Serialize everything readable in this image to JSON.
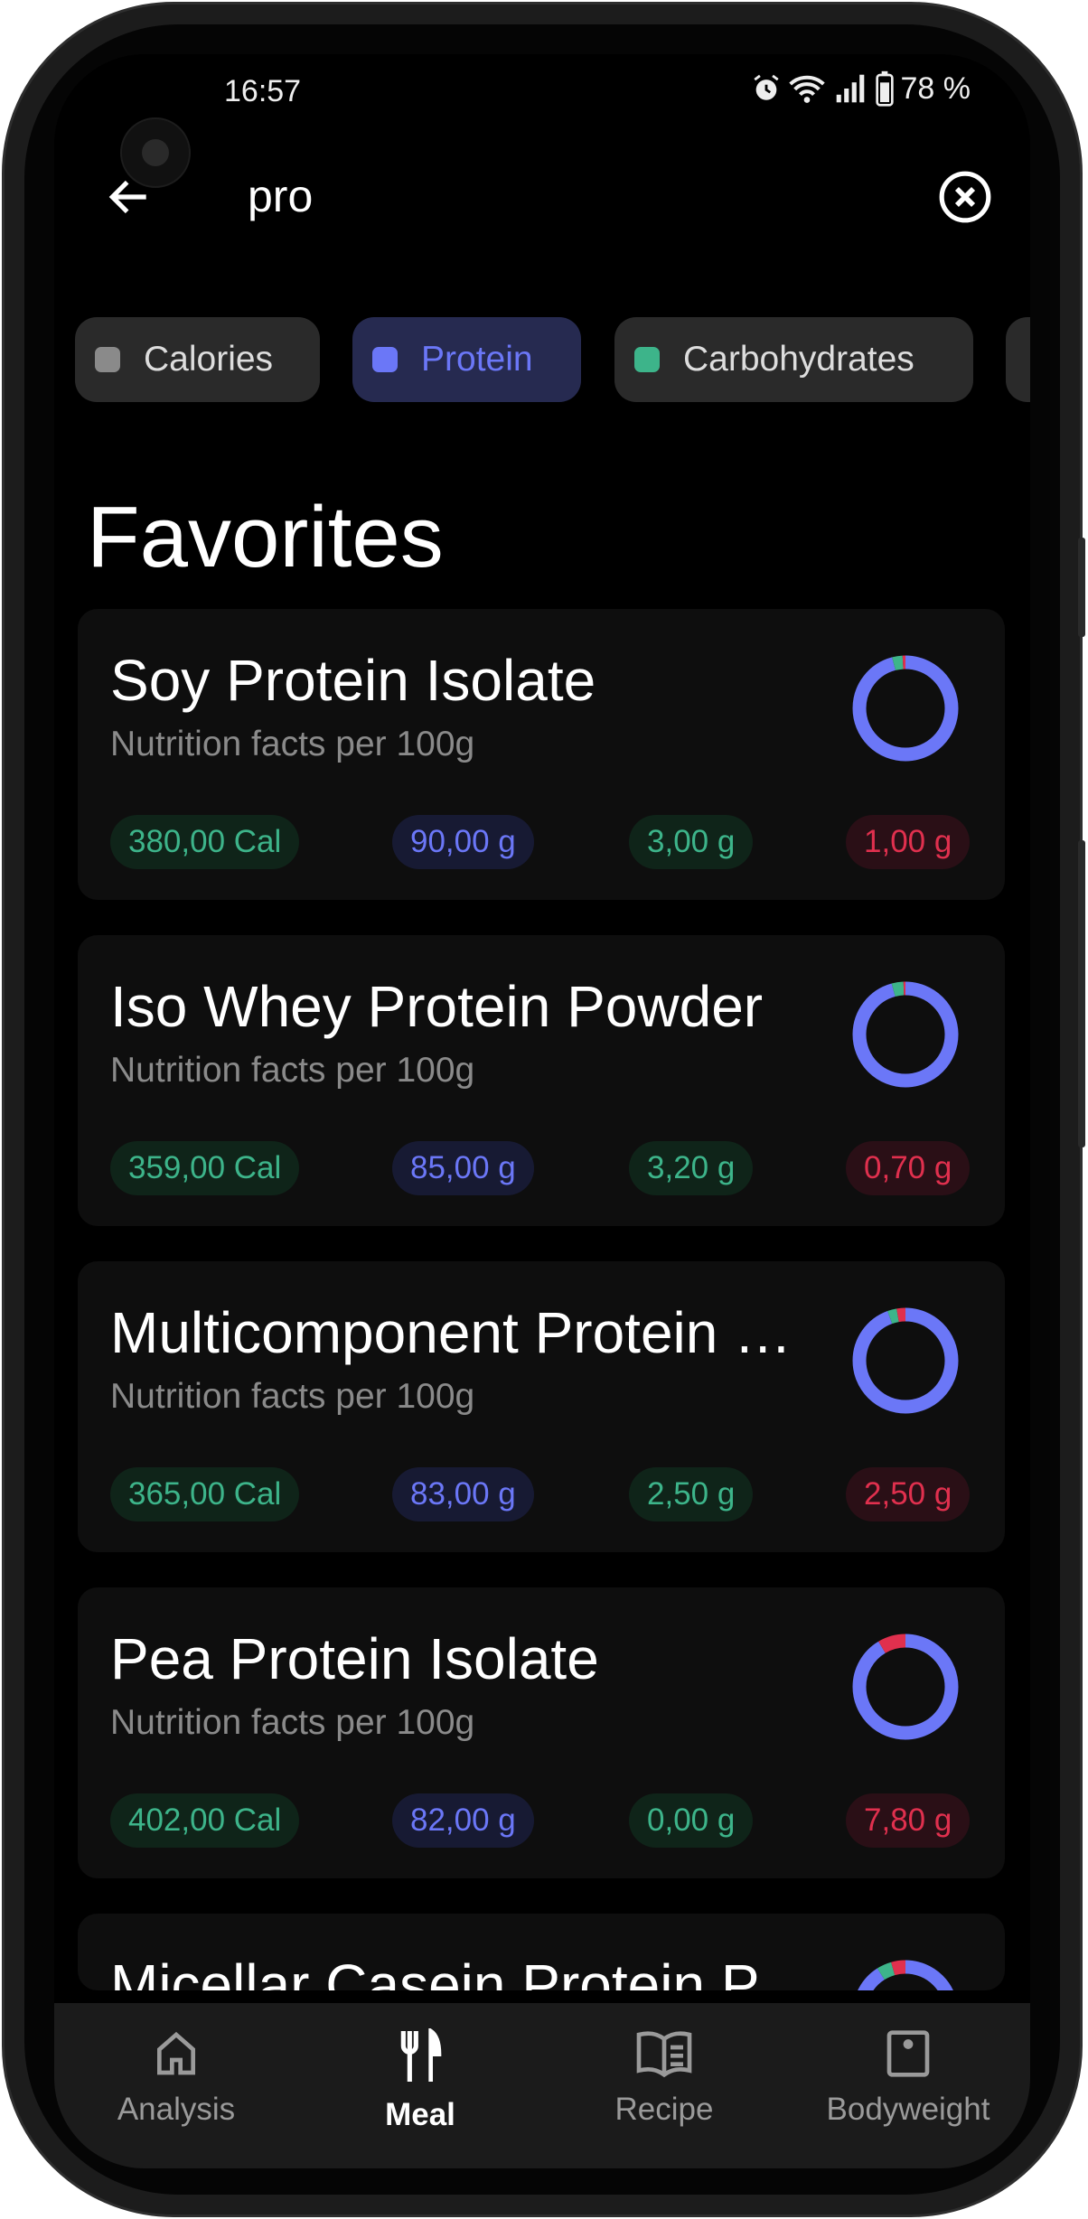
{
  "status_bar": {
    "time": "16:57",
    "battery": "78 %",
    "icons": [
      "alarm-icon",
      "wifi-icon",
      "signal-icon",
      "battery-icon"
    ]
  },
  "search": {
    "value": "pro",
    "back_icon": "arrow-left-icon",
    "clear_icon": "close-circle-icon"
  },
  "filters": [
    {
      "label": "Calories",
      "color": "#8a8a8a",
      "selected": false
    },
    {
      "label": "Protein",
      "color": "#6b77f7",
      "selected": true
    },
    {
      "label": "Carbohydrates",
      "color": "#3db48a",
      "selected": false
    }
  ],
  "section_title": "Favorites",
  "colors": {
    "protein": "#6b77f7",
    "carbs": "#3db48a",
    "fat": "#e0304e",
    "calories": "#3db48a"
  },
  "foods": [
    {
      "name": "Soy Protein Isolate",
      "subtitle": "Nutrition facts per 100g",
      "calories": "380,00 Cal",
      "protein": "90,00 g",
      "carbs": "3,00 g",
      "fat": "1,00 g",
      "macros": [
        90,
        3,
        1
      ]
    },
    {
      "name": "Iso Whey Protein Powder",
      "subtitle": "Nutrition facts per 100g",
      "calories": "359,00 Cal",
      "protein": "85,00 g",
      "carbs": "3,20 g",
      "fat": "0,70 g",
      "macros": [
        85,
        3.2,
        0.7
      ]
    },
    {
      "name": "Multicomponent Protein …",
      "subtitle": "Nutrition facts per 100g",
      "calories": "365,00 Cal",
      "protein": "83,00 g",
      "carbs": "2,50 g",
      "fat": "2,50 g",
      "macros": [
        83,
        2.5,
        2.5
      ]
    },
    {
      "name": "Pea Protein Isolate",
      "subtitle": "Nutrition facts per 100g",
      "calories": "402,00 Cal",
      "protein": "82,00 g",
      "carbs": "0,00 g",
      "fat": "7,80 g",
      "macros": [
        82,
        0,
        7.8
      ]
    },
    {
      "name": "Micellar Casein Protein P"
    }
  ],
  "nav": [
    {
      "label": "Analysis",
      "icon": "home-icon",
      "active": false
    },
    {
      "label": "Meal",
      "icon": "fork-knife-icon",
      "active": true
    },
    {
      "label": "Recipe",
      "icon": "book-icon",
      "active": false
    },
    {
      "label": "Bodyweight",
      "icon": "scale-icon",
      "active": false
    }
  ]
}
